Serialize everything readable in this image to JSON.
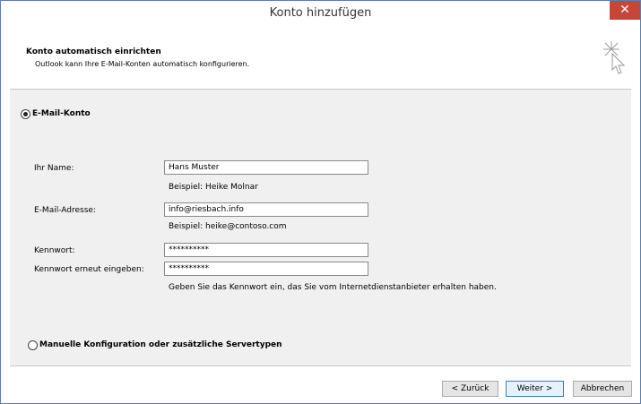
{
  "window": {
    "title": "Konto hinzufügen",
    "close_glyph": "✕"
  },
  "header": {
    "title": "Konto automatisch einrichten",
    "subtitle": "Outlook kann Ihre E-Mail-Konten automatisch konfigurieren.",
    "icon": "sparkle-cursor-icon"
  },
  "options": {
    "email_account": {
      "label": "E-Mail-Konto",
      "checked": true
    },
    "manual_config": {
      "label": "Manuelle Konfiguration oder zusätzliche Servertypen",
      "checked": false
    }
  },
  "form": {
    "name": {
      "label": "Ihr Name:",
      "value": "Hans Muster",
      "hint": "Beispiel: Heike Molnar"
    },
    "email": {
      "label": "E-Mail-Adresse:",
      "value": "info@riesbach.info",
      "hint": "Beispiel: heike@contoso.com"
    },
    "password": {
      "label": "Kennwort:",
      "value": "**********"
    },
    "password_repeat": {
      "label": "Kennwort erneut eingeben:",
      "value": "**********"
    },
    "password_info": "Geben Sie das Kennwort ein, das Sie vom Internetdienstanbieter erhalten haben."
  },
  "buttons": {
    "back": "< Zurück",
    "next": "Weiter >",
    "cancel": "Abbrechen"
  }
}
